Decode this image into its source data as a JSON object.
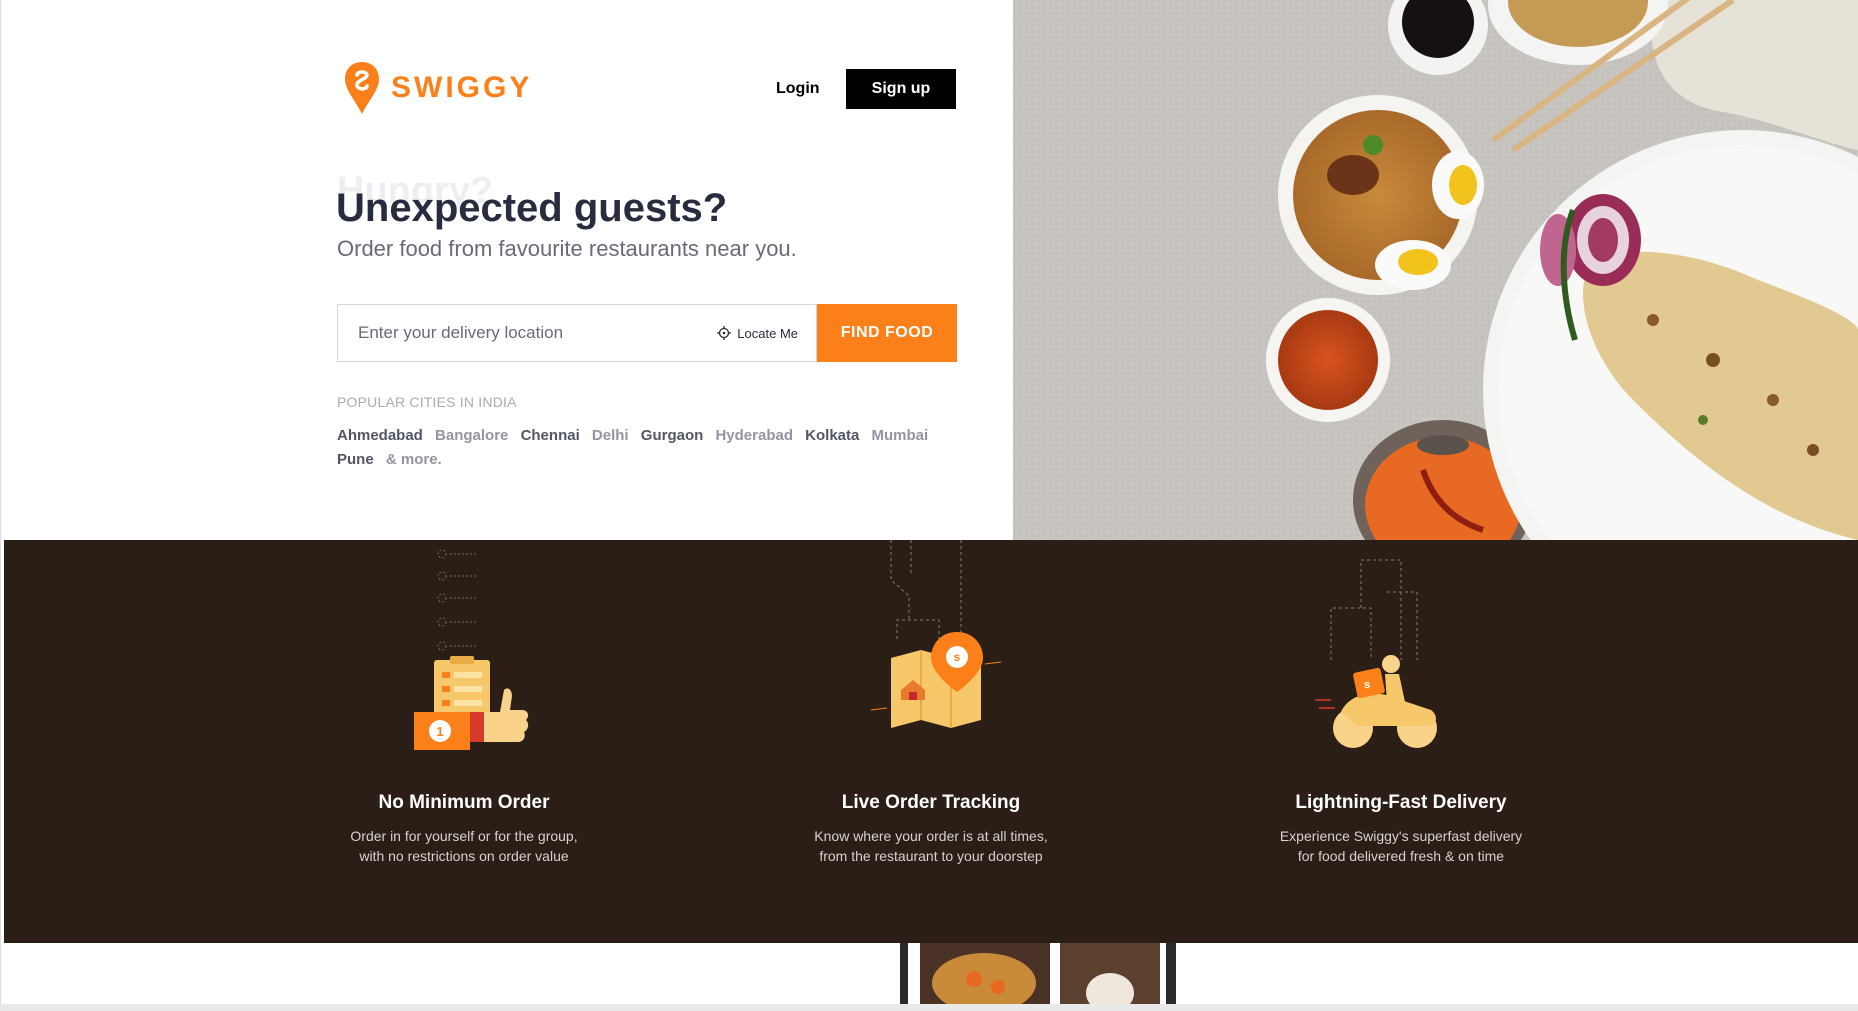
{
  "brand": {
    "name": "SWIGGY",
    "accent": "#fc8019"
  },
  "header": {
    "login_label": "Login",
    "signup_label": "Sign up"
  },
  "hero": {
    "ghost_title": "Hungry?",
    "title": "Unexpected guests?",
    "subtitle": "Order food from favourite restaurants near you.",
    "search": {
      "placeholder": "Enter your delivery location",
      "value": ""
    },
    "locate_label": "Locate Me",
    "find_label": "FIND FOOD",
    "popular_title": "POPULAR CITIES IN INDIA",
    "cities": [
      "Ahmedabad",
      "Bangalore",
      "Chennai",
      "Delhi",
      "Gurgaon",
      "Hyderabad",
      "Kolkata",
      "Mumbai",
      "Pune"
    ],
    "more_label": "& more."
  },
  "features": [
    {
      "title": "No Minimum Order",
      "desc": "Order in for yourself or for the group,\nwith no restrictions on order value"
    },
    {
      "title": "Live Order Tracking",
      "desc": "Know where your order is at all times,\nfrom the restaurant to your doorstep"
    },
    {
      "title": "Lightning-Fast Delivery",
      "desc": "Experience Swiggy's superfast delivery\nfor food delivered fresh & on time"
    }
  ],
  "icons": {
    "logo": "swiggy-logo-icon",
    "locate": "crosshair-icon",
    "feature1": "clipboard-thumbs-up-icon",
    "feature2": "map-pin-icon",
    "feature3": "scooter-icon"
  }
}
